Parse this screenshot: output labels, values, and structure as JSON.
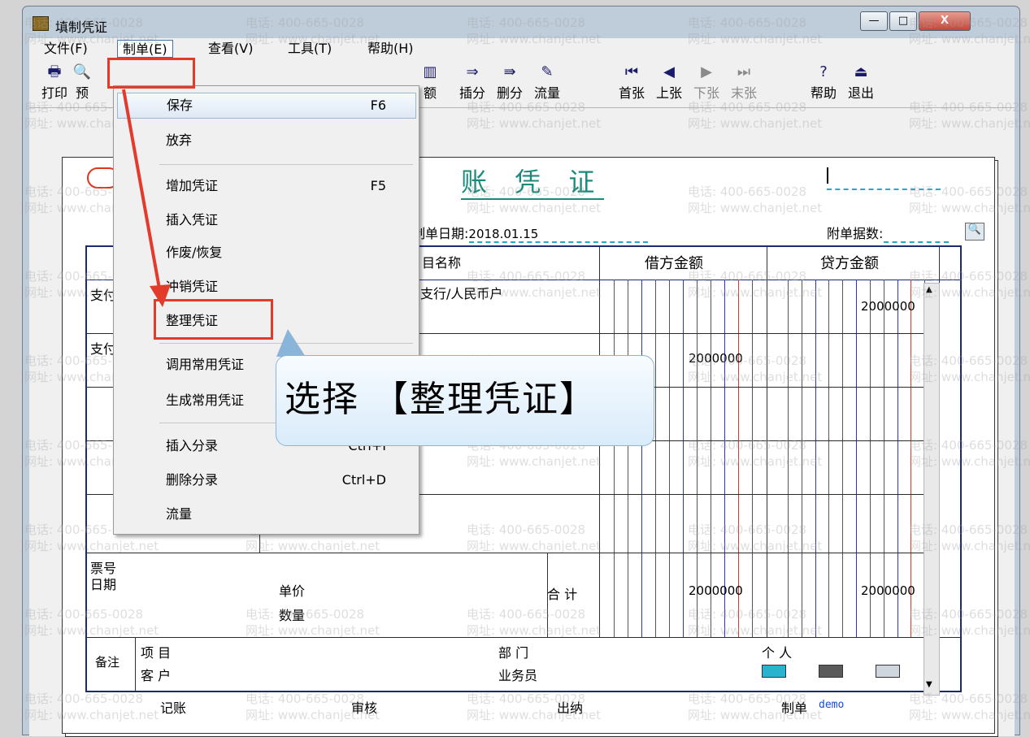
{
  "window": {
    "title": "填制凭证",
    "min_label": "—",
    "max_label": "□",
    "close_label": "X"
  },
  "menubar": [
    "文件(F)",
    "制单(E)",
    "查看(V)",
    "工具(T)",
    "帮助(H)"
  ],
  "toolbar": {
    "left": [
      {
        "label": "打印",
        "icon": "🖶"
      },
      {
        "label": "预",
        "icon": "🔍"
      }
    ],
    "right": [
      {
        "label": "额",
        "icon": "▥"
      },
      {
        "label": "插分",
        "icon": "⇒"
      },
      {
        "label": "删分",
        "icon": "⇛"
      },
      {
        "label": "流量",
        "icon": "✎"
      },
      {
        "label": "首张",
        "icon": "⏮"
      },
      {
        "label": "上张",
        "icon": "◀"
      },
      {
        "label": "下张",
        "icon": "▶"
      },
      {
        "label": "末张",
        "icon": "⏭"
      },
      {
        "label": "帮助",
        "icon": "?"
      },
      {
        "label": "退出",
        "icon": "⏏"
      }
    ]
  },
  "dropdown": [
    {
      "label": "保存",
      "key": "F6"
    },
    {
      "label": "放弃",
      "key": ""
    },
    {
      "label": "增加凭证",
      "key": "F5"
    },
    {
      "label": "插入凭证",
      "key": ""
    },
    {
      "label": "作废/恢复",
      "key": ""
    },
    {
      "label": "冲销凭证",
      "key": ""
    },
    {
      "label": "整理凭证",
      "key": ""
    },
    {
      "label": "调用常用凭证",
      "key": ""
    },
    {
      "label": "生成常用凭证",
      "key": ""
    },
    {
      "label": "插入分录",
      "key": "Ctrl+I"
    },
    {
      "label": "删除分录",
      "key": "Ctrl+D"
    },
    {
      "label": "流量",
      "key": ""
    }
  ],
  "voucher": {
    "title": "账 凭 证",
    "date_label": "制单日期:",
    "date_value": "2018.01.15",
    "attach_label": "附单据数:",
    "col_name_label": "目名称",
    "debit_label": "借方金额",
    "credit_label": "贷方金额",
    "row1_summary": "支付",
    "row1_account": "支行/人民币户",
    "row1_credit": "2000000",
    "row2_summary": "支付",
    "row2_debit": "2000000",
    "ticket_label": "票号",
    "date_row_label": "日期",
    "price_label": "单价",
    "qty_label": "数量",
    "total_label": "合 计",
    "total_debit": "2000000",
    "total_credit": "2000000",
    "note_label": "备注",
    "item_label": "项 目",
    "customer_label": "客 户",
    "dept_label": "部 门",
    "salesman_label": "业务员",
    "person_label": "个 人",
    "bookkeep_label": "记账",
    "audit_label": "审核",
    "cashier_label": "出纳",
    "maker_label": "制单",
    "maker_value": "demo"
  },
  "callout_text": "选择 【整理凭证】",
  "watermark": {
    "phone": "电话: 400-665-0028",
    "site": "网址: www.chanjet.net"
  },
  "colors": {
    "highlight_red": "#e23b2b",
    "title_teal": "#1a8a7a",
    "grid_blue": "#1e2a6e"
  }
}
